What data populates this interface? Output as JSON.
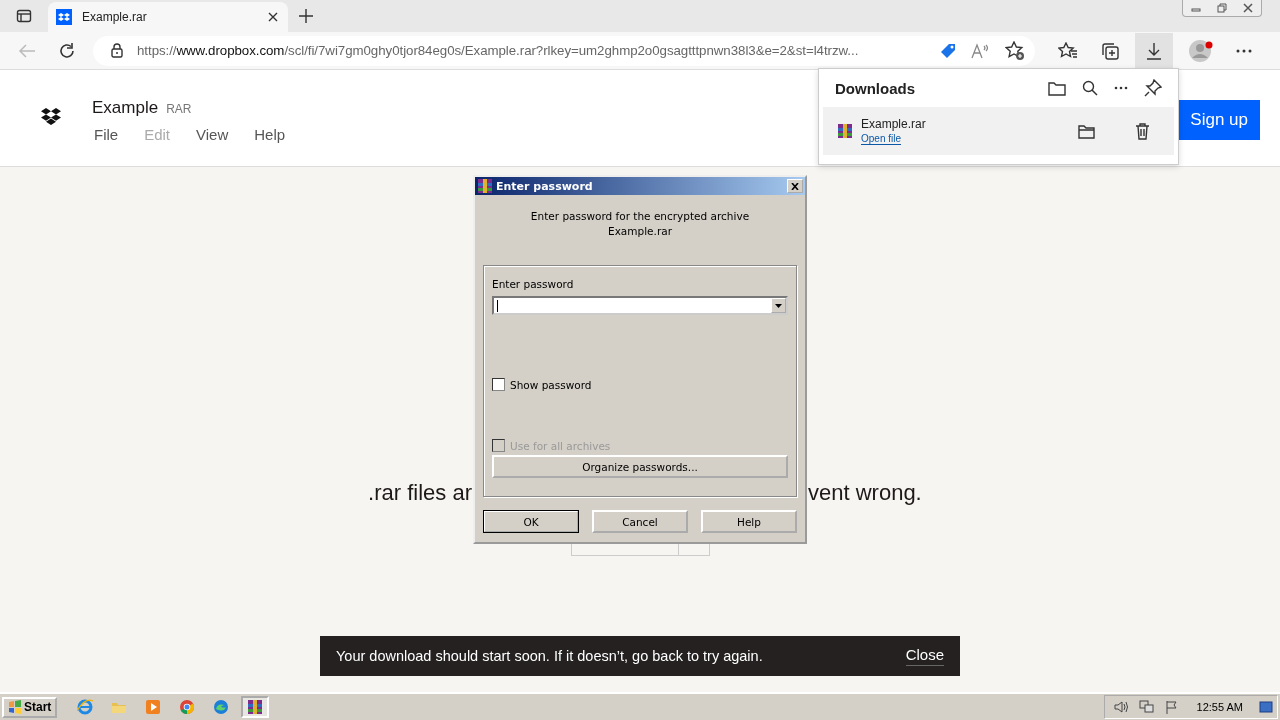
{
  "browser": {
    "tabs": [
      {
        "title": "Example.rar",
        "selected": true
      }
    ],
    "url": {
      "scheme": "https://",
      "host": "www.dropbox.com",
      "path": "/scl/fi/7wi7gm0ghy0tjor84eg0s/Example.rar?rlkey=um2ghmp2o0gsagtttpnwn38l3&e=2&st=l4trzw..."
    }
  },
  "page": {
    "title": "Example",
    "file_type": "RAR",
    "menu": [
      {
        "label": "File",
        "disabled": false
      },
      {
        "label": "Edit",
        "disabled": true
      },
      {
        "label": "View",
        "disabled": false
      },
      {
        "label": "Help",
        "disabled": false
      }
    ],
    "signup": "Sign up",
    "message_left": ".rar files ar",
    "message_right": "vent wrong."
  },
  "downloads_panel": {
    "title": "Downloads",
    "items": [
      {
        "name": "Example.rar",
        "action": "Open file"
      }
    ]
  },
  "dialog": {
    "title": "Enter password",
    "message": [
      "Enter password for the encrypted archive",
      "Example.rar"
    ],
    "password_label": "Enter password",
    "options": [
      {
        "label": "Show password",
        "checked": false,
        "disabled": false
      },
      {
        "label": "Use for all archives",
        "checked": false,
        "disabled": true
      }
    ],
    "organize_button": "Organize passwords...",
    "buttons": [
      {
        "label": "OK",
        "default": true
      },
      {
        "label": "Cancel",
        "default": false
      },
      {
        "label": "Help",
        "default": false
      }
    ]
  },
  "toast": {
    "message": "Your download should start soon. If it doesn’t, go back to try again.",
    "close": "Close"
  },
  "taskbar": {
    "start": "Start",
    "apps": [
      {
        "kind": "ie",
        "selected": false
      },
      {
        "kind": "explorer",
        "selected": false
      },
      {
        "kind": "media",
        "selected": false
      },
      {
        "kind": "chrome",
        "selected": false
      },
      {
        "kind": "edge",
        "selected": false
      },
      {
        "kind": "winrar",
        "selected": true
      }
    ],
    "clock": "12:55 AM"
  }
}
